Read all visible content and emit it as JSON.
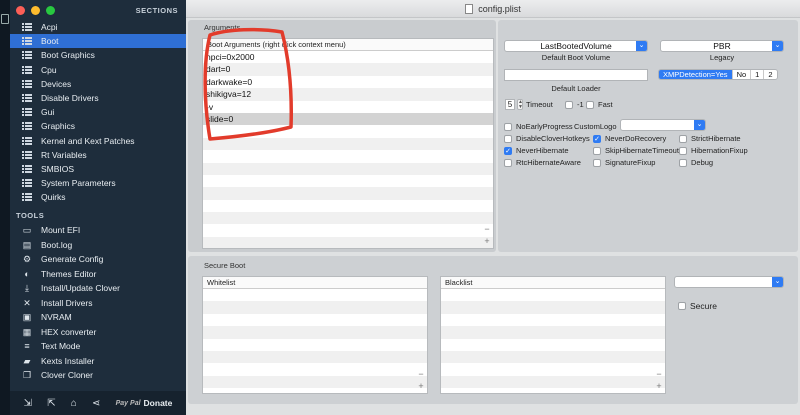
{
  "colors": {
    "accent": "#2f7bf3",
    "sidebar_active": "#2f6fd4",
    "annotation": "#e23b2b"
  },
  "window": {
    "title": "config.plist"
  },
  "sidebar": {
    "sections_title": "SECTIONS",
    "items": [
      {
        "label": "Acpi"
      },
      {
        "label": "Boot"
      },
      {
        "label": "Boot Graphics"
      },
      {
        "label": "Cpu"
      },
      {
        "label": "Devices"
      },
      {
        "label": "Disable Drivers"
      },
      {
        "label": "Gui"
      },
      {
        "label": "Graphics"
      },
      {
        "label": "Kernel and Kext Patches"
      },
      {
        "label": "Rt Variables"
      },
      {
        "label": "SMBIOS"
      },
      {
        "label": "System Parameters"
      },
      {
        "label": "Quirks"
      }
    ],
    "active_index": 1,
    "tools_title": "TOOLS",
    "tools": [
      {
        "label": "Mount EFI",
        "icon": "disk-icon"
      },
      {
        "label": "Boot.log",
        "icon": "document-icon"
      },
      {
        "label": "Generate Config",
        "icon": "gear-icon"
      },
      {
        "label": "Themes Editor",
        "icon": "palette-icon"
      },
      {
        "label": "Install/Update Clover",
        "icon": "download-icon"
      },
      {
        "label": "Install Drivers",
        "icon": "wrench-icon"
      },
      {
        "label": "NVRAM",
        "icon": "chip-icon"
      },
      {
        "label": "HEX converter",
        "icon": "grid-icon"
      },
      {
        "label": "Text Mode",
        "icon": "text-icon"
      },
      {
        "label": "Kexts Installer",
        "icon": "box-icon"
      },
      {
        "label": "Clover Cloner",
        "icon": "copy-icon"
      }
    ],
    "bottom": {
      "donate_label": "Donate",
      "paypal_label": "Pay Pal"
    }
  },
  "arguments": {
    "group_label": "Arguments",
    "header": "Boot Arguments (right click context menu)",
    "rows": [
      "npci=0x2000",
      "dart=0",
      "darkwake=0",
      "shikigva=12",
      "-v",
      "slide=0"
    ],
    "selected_row": 5
  },
  "boot_options": {
    "default_volume": {
      "value": "LastBootedVolume",
      "caption": "Default Boot Volume"
    },
    "legacy": {
      "value": "PBR",
      "caption": "Legacy"
    },
    "default_loader": {
      "value": "",
      "caption": "Default Loader"
    },
    "xmp_segment": {
      "options": [
        "XMPDetection=Yes",
        "No",
        "1",
        "2"
      ],
      "selected": 0
    },
    "timeout": {
      "value": "5",
      "label": "Timeout"
    },
    "minus_one": {
      "label": "-1",
      "checked": false
    },
    "fast": {
      "label": "Fast",
      "checked": false
    },
    "no_early_progress": {
      "label": "NoEarlyProgress",
      "checked": false
    },
    "custom_logo": {
      "label": "CustomLogo",
      "value": ""
    },
    "disable_clover_hotkeys": {
      "label": "DisableCloverHotkeys",
      "checked": false
    },
    "never_do_recovery": {
      "label": "NeverDoRecovery",
      "checked": true
    },
    "strict_hibernate": {
      "label": "StrictHibernate",
      "checked": false
    },
    "never_hibernate": {
      "label": "NeverHibernate",
      "checked": true
    },
    "skip_hibernate_timeout": {
      "label": "SkipHibernateTimeout",
      "checked": false
    },
    "hibernation_fixup": {
      "label": "HibernationFixup",
      "checked": false
    },
    "rtc_hibernate_aware": {
      "label": "RtcHibernateAware",
      "checked": false
    },
    "signature_fixup": {
      "label": "SignatureFixup",
      "checked": false
    },
    "debug": {
      "label": "Debug",
      "checked": false
    }
  },
  "secure_boot": {
    "group_label": "Secure Boot",
    "whitelist_header": "Whitelist",
    "blacklist_header": "Blacklist",
    "policy_value": "",
    "secure": {
      "label": "Secure",
      "checked": false
    }
  }
}
